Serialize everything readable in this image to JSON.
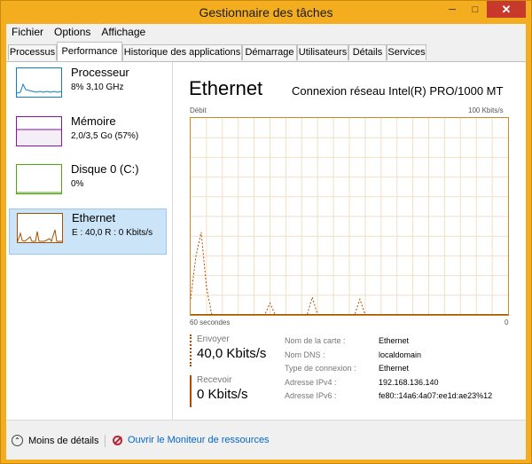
{
  "window": {
    "title": "Gestionnaire des tâches"
  },
  "menu": [
    "Fichier",
    "Options",
    "Affichage"
  ],
  "tabs": [
    "Processus",
    "Performance",
    "Historique des applications",
    "Démarrage",
    "Utilisateurs",
    "Détails",
    "Services"
  ],
  "active_tab": "Performance",
  "sidebar": [
    {
      "name": "Processeur",
      "sub": "8%  3,10 GHz",
      "color": "#117dbb"
    },
    {
      "name": "Mémoire",
      "sub": "2,0/3,5 Go (57%)",
      "color": "#8b12ae"
    },
    {
      "name": "Disque 0 (C:)",
      "sub": "0%",
      "color": "#4da60c"
    },
    {
      "name": "Ethernet",
      "sub": "E : 40,0 R : 0 Kbits/s",
      "color": "#a74f01"
    }
  ],
  "main": {
    "title": "Ethernet",
    "adapter": "Connexion réseau Intel(R) PRO/1000 MT",
    "y_label": "Débit",
    "y_max_label": "100 Kbits/s",
    "x_left_label": "60 secondes",
    "x_right_label": "0",
    "send": {
      "label": "Envoyer",
      "value": "40,0 Kbits/s"
    },
    "receive": {
      "label": "Recevoir",
      "value": "0 Kbits/s"
    },
    "properties": [
      {
        "key": "Nom de la carte :",
        "value": "Ethernet"
      },
      {
        "key": "Nom DNS :",
        "value": "localdomain"
      },
      {
        "key": "Type de connexion :",
        "value": "Ethernet"
      },
      {
        "key": "Adresse IPv4 :",
        "value": "192.168.136.140"
      },
      {
        "key": "Adresse IPv6 :",
        "value": "fe80::14a6:4a07:ee1d:ae23%12"
      }
    ]
  },
  "footer": {
    "fewer_details": "Moins de détails",
    "open_monitor": "Ouvrir le Moniteur de ressources"
  },
  "colors": {
    "accent": "#f0a30a",
    "ethernet": "#a74f01",
    "grid": "#f2dfc7"
  },
  "chart_data": {
    "type": "line",
    "ylabel": "Débit",
    "y_max": "100 Kbits/s",
    "xlabel": "60 secondes",
    "ylim": [
      0,
      100
    ],
    "x": [
      0,
      1,
      2,
      3,
      4,
      5,
      6,
      7,
      8,
      9,
      10,
      11,
      12,
      13,
      14,
      15,
      16,
      17,
      18,
      19,
      20,
      21,
      22,
      23,
      24,
      25,
      26,
      27,
      28,
      29,
      30,
      31,
      32,
      33,
      34,
      35,
      36,
      37,
      38,
      39,
      40,
      41,
      42,
      43,
      44,
      45,
      46,
      47,
      48,
      49,
      50,
      51,
      52,
      53,
      54,
      55,
      56,
      57,
      58,
      59,
      60
    ],
    "series": [
      {
        "values": [
          0,
          0,
          0,
          0,
          0,
          0,
          0,
          0,
          0,
          0,
          0,
          0,
          0,
          0,
          0,
          0,
          0,
          0,
          0,
          0,
          0,
          0,
          0,
          0,
          0,
          0,
          0,
          0,
          0,
          0,
          0,
          0,
          0,
          0,
          0,
          0,
          0,
          0,
          0,
          0,
          0,
          0,
          0,
          0,
          0,
          0,
          0,
          0,
          0,
          0,
          0,
          0,
          0,
          0,
          0,
          0,
          0,
          0,
          0,
          0,
          0
        ]
      },
      {
        "values": [
          8,
          0,
          0,
          6,
          0,
          0,
          0,
          0,
          0,
          0,
          0,
          0,
          0,
          0,
          0,
          6,
          0,
          0,
          0,
          0,
          0,
          0,
          0,
          9,
          0,
          0,
          0,
          0,
          0,
          0,
          0,
          0,
          0,
          0,
          0,
          0,
          0,
          0,
          0,
          0,
          0,
          0,
          0,
          0,
          0,
          0,
          0,
          0,
          0,
          0,
          0,
          0,
          0,
          0,
          0,
          0,
          0,
          0,
          0,
          0,
          0
        ]
      },
      {
        "values": [
          0,
          30,
          42,
          8,
          0,
          0,
          0,
          0,
          0,
          0,
          0,
          0,
          0,
          0,
          0,
          0,
          0,
          0,
          0,
          0,
          0,
          0,
          0,
          0,
          0,
          0,
          0,
          0,
          0,
          0,
          0,
          0,
          8,
          0,
          0,
          0,
          0,
          0,
          0,
          0,
          0,
          0,
          0,
          0,
          0,
          0,
          0,
          0,
          0,
          0,
          0,
          0,
          0,
          0,
          0,
          0,
          0,
          0,
          0,
          0,
          0
        ]
      },
      {
        "values": [
          0,
          0,
          0,
          0,
          0,
          0,
          0,
          0,
          0,
          0,
          0,
          0,
          0,
          0,
          0,
          0,
          0,
          0,
          0,
          0,
          0,
          0,
          0,
          0,
          0,
          0,
          0,
          0,
          0,
          0,
          0,
          0,
          0,
          0,
          0,
          0,
          0,
          0,
          0,
          0,
          0,
          0,
          0,
          0,
          0,
          0,
          0,
          0,
          0,
          0,
          0,
          0,
          0,
          0,
          0,
          0,
          0,
          0,
          0,
          0,
          0
        ]
      }
    ],
    "annotations": [],
    "grid": true
  }
}
